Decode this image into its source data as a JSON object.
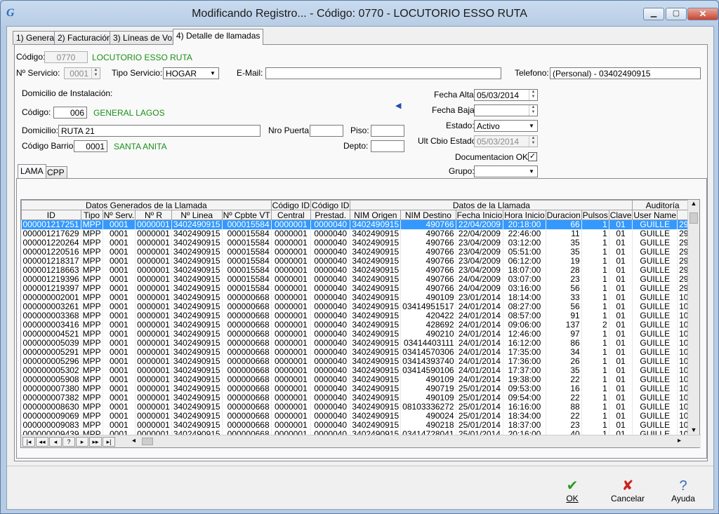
{
  "window": {
    "title": "Modificando Registro... - Código: 0770 - LOCUTORIO ESSO RUTA",
    "app_logo": "G"
  },
  "tabs": [
    {
      "label": "1) General"
    },
    {
      "label": "2) Facturación"
    },
    {
      "label": "3) Líneas de Voz"
    },
    {
      "label": "4) Detalle de llamadas"
    }
  ],
  "header": {
    "codigo_label": "Código:",
    "codigo": "0770",
    "nombre": "LOCUTORIO ESSO RUTA",
    "nservicio_label": "Nº Servicio:",
    "nservicio": "0001",
    "tiposervicio_label": "Tipo Servicio:",
    "tiposervicio": "HOGAR",
    "email_label": "E-Mail:",
    "email": "",
    "telefono_label": "Telefono:",
    "telefono": "(Personal) - 03402490915"
  },
  "domicilio": {
    "section_label": "Domicilio de Instalación:",
    "codigo_label": "Código:",
    "codigo": "006",
    "localidad": "GENERAL LAGOS",
    "domicilio_label": "Domicilio:",
    "domicilio": "RUTA 21",
    "nropuerta_label": "Nro Puerta:",
    "nropuerta": "",
    "piso_label": "Piso:",
    "piso": "",
    "depto_label": "Depto:",
    "depto": "",
    "barrio_label": "Código Barrio:",
    "barrio": "0001",
    "barrio_nombre": "SANTA ANITA"
  },
  "estado": {
    "alta_label": "Fecha Alta:",
    "alta": "05/03/2014",
    "baja_label": "Fecha Baja:",
    "baja": "",
    "estado_label": "Estado:",
    "estado": "Activo",
    "ult_label": "Ult Cbio Estado:",
    "ult": "05/03/2014",
    "doc_label": "Documentacion OK",
    "doc_checked": "✓",
    "grupo_label": "Grupo:",
    "grupo": ""
  },
  "subtabs": [
    {
      "label": "LAMA"
    },
    {
      "label": "CPP"
    }
  ],
  "grid": {
    "groups": [
      {
        "label": "Datos Generados de la Llamada",
        "span": 6
      },
      {
        "label": "Código ID",
        "span": 1
      },
      {
        "label": "Código ID",
        "span": 1
      },
      {
        "label": "Datos de la Llamada",
        "span": 7
      },
      {
        "label": "Auditoría",
        "span": 2
      }
    ],
    "columns": [
      "ID",
      "Tipo",
      "Nº Serv.",
      "Nº R",
      "Nº Linea",
      "Nº Cpbte VT",
      "Central",
      "Prestad.",
      "NIM Origen",
      "NIM Destino",
      "Fecha Inicio",
      "Hora Inicio",
      "Duracion",
      "Pulsos",
      "Clave",
      "User Name",
      ""
    ],
    "rows": [
      [
        "000001217251",
        "MPP",
        "0001",
        "0000001",
        "3402490915",
        "000015584",
        "0000001",
        "0000040",
        "3402490915",
        "490766",
        "22/04/2009",
        "20:18:00",
        "66",
        "1",
        "01",
        "GUILLE",
        "29."
      ],
      [
        "000001217629",
        "MPP",
        "0001",
        "0000001",
        "3402490915",
        "000015584",
        "0000001",
        "0000040",
        "3402490915",
        "490766",
        "22/04/2009",
        "22:46:00",
        "11",
        "1",
        "01",
        "GUILLE",
        "29."
      ],
      [
        "000001220264",
        "MPP",
        "0001",
        "0000001",
        "3402490915",
        "000015584",
        "0000001",
        "0000040",
        "3402490915",
        "490766",
        "23/04/2009",
        "03:12:00",
        "35",
        "1",
        "01",
        "GUILLE",
        "29."
      ],
      [
        "000001220516",
        "MPP",
        "0001",
        "0000001",
        "3402490915",
        "000015584",
        "0000001",
        "0000040",
        "3402490915",
        "490766",
        "23/04/2009",
        "05:51:00",
        "35",
        "1",
        "01",
        "GUILLE",
        "29."
      ],
      [
        "000001218317",
        "MPP",
        "0001",
        "0000001",
        "3402490915",
        "000015584",
        "0000001",
        "0000040",
        "3402490915",
        "490766",
        "23/04/2009",
        "06:12:00",
        "19",
        "1",
        "01",
        "GUILLE",
        "29."
      ],
      [
        "000001218663",
        "MPP",
        "0001",
        "0000001",
        "3402490915",
        "000015584",
        "0000001",
        "0000040",
        "3402490915",
        "490766",
        "23/04/2009",
        "18:07:00",
        "28",
        "1",
        "01",
        "GUILLE",
        "29."
      ],
      [
        "000001219396",
        "MPP",
        "0001",
        "0000001",
        "3402490915",
        "000015584",
        "0000001",
        "0000040",
        "3402490915",
        "490766",
        "24/04/2009",
        "03:07:00",
        "23",
        "1",
        "01",
        "GUILLE",
        "29."
      ],
      [
        "000001219397",
        "MPP",
        "0001",
        "0000001",
        "3402490915",
        "000015584",
        "0000001",
        "0000040",
        "3402490915",
        "490766",
        "24/04/2009",
        "03:16:00",
        "56",
        "1",
        "01",
        "GUILLE",
        "29."
      ],
      [
        "000000002001",
        "MPP",
        "0001",
        "0000001",
        "3402490915",
        "000000668",
        "0000001",
        "0000040",
        "3402490915",
        "490109",
        "23/01/2014",
        "18:14:00",
        "33",
        "1",
        "01",
        "GUILLE",
        "10."
      ],
      [
        "000000003261",
        "MPP",
        "0001",
        "0000001",
        "3402490915",
        "000000668",
        "0000001",
        "0000040",
        "3402490915",
        "03414951517",
        "24/01/2014",
        "08:27:00",
        "56",
        "1",
        "01",
        "GUILLE",
        "10."
      ],
      [
        "000000003368",
        "MPP",
        "0001",
        "0000001",
        "3402490915",
        "000000668",
        "0000001",
        "0000040",
        "3402490915",
        "420422",
        "24/01/2014",
        "08:57:00",
        "91",
        "1",
        "01",
        "GUILLE",
        "10."
      ],
      [
        "000000003416",
        "MPP",
        "0001",
        "0000001",
        "3402490915",
        "000000668",
        "0000001",
        "0000040",
        "3402490915",
        "428692",
        "24/01/2014",
        "09:06:00",
        "137",
        "2",
        "01",
        "GUILLE",
        "10."
      ],
      [
        "000000004521",
        "MPP",
        "0001",
        "0000001",
        "3402490915",
        "000000668",
        "0000001",
        "0000040",
        "3402490915",
        "490210",
        "24/01/2014",
        "12:46:00",
        "97",
        "1",
        "01",
        "GUILLE",
        "10."
      ],
      [
        "000000005039",
        "MPP",
        "0001",
        "0000001",
        "3402490915",
        "000000668",
        "0000001",
        "0000040",
        "3402490915",
        "03414403111",
        "24/01/2014",
        "16:12:00",
        "86",
        "1",
        "01",
        "GUILLE",
        "10."
      ],
      [
        "000000005291",
        "MPP",
        "0001",
        "0000001",
        "3402490915",
        "000000668",
        "0000001",
        "0000040",
        "3402490915",
        "03414570306",
        "24/01/2014",
        "17:35:00",
        "34",
        "1",
        "01",
        "GUILLE",
        "10."
      ],
      [
        "000000005296",
        "MPP",
        "0001",
        "0000001",
        "3402490915",
        "000000668",
        "0000001",
        "0000040",
        "3402490915",
        "03414393740",
        "24/01/2014",
        "17:36:00",
        "26",
        "1",
        "01",
        "GUILLE",
        "10."
      ],
      [
        "000000005302",
        "MPP",
        "0001",
        "0000001",
        "3402490915",
        "000000668",
        "0000001",
        "0000040",
        "3402490915",
        "03414590106",
        "24/01/2014",
        "17:37:00",
        "35",
        "1",
        "01",
        "GUILLE",
        "10."
      ],
      [
        "000000005908",
        "MPP",
        "0001",
        "0000001",
        "3402490915",
        "000000668",
        "0000001",
        "0000040",
        "3402490915",
        "490109",
        "24/01/2014",
        "19:38:00",
        "22",
        "1",
        "01",
        "GUILLE",
        "10."
      ],
      [
        "000000007380",
        "MPP",
        "0001",
        "0000001",
        "3402490915",
        "000000668",
        "0000001",
        "0000040",
        "3402490915",
        "490719",
        "25/01/2014",
        "09:53:00",
        "16",
        "1",
        "01",
        "GUILLE",
        "10."
      ],
      [
        "000000007382",
        "MPP",
        "0001",
        "0000001",
        "3402490915",
        "000000668",
        "0000001",
        "0000040",
        "3402490915",
        "490109",
        "25/01/2014",
        "09:54:00",
        "22",
        "1",
        "01",
        "GUILLE",
        "10."
      ],
      [
        "000000008630",
        "MPP",
        "0001",
        "0000001",
        "3402490915",
        "000000668",
        "0000001",
        "0000040",
        "3402490915",
        "08103336272",
        "25/01/2014",
        "16:16:00",
        "88",
        "1",
        "01",
        "GUILLE",
        "10."
      ],
      [
        "000000009069",
        "MPP",
        "0001",
        "0000001",
        "3402490915",
        "000000668",
        "0000001",
        "0000040",
        "3402490915",
        "490024",
        "25/01/2014",
        "18:34:00",
        "22",
        "1",
        "01",
        "GUILLE",
        "10."
      ],
      [
        "000000009083",
        "MPP",
        "0001",
        "0000001",
        "3402490915",
        "000000668",
        "0000001",
        "0000040",
        "3402490915",
        "490218",
        "25/01/2014",
        "18:37:00",
        "23",
        "1",
        "01",
        "GUILLE",
        "10."
      ],
      [
        "000000009439",
        "MPP",
        "0001",
        "0000001",
        "3402490915",
        "000000668",
        "0000001",
        "0000040",
        "3402490915",
        "03414728041",
        "25/01/2014",
        "20:16:00",
        "40",
        "1",
        "01",
        "GUILLE",
        "10."
      ]
    ]
  },
  "navigator": [
    "|◂",
    "◂◂",
    "◂",
    "?",
    "▸",
    "▸▸",
    "▸|"
  ],
  "buttons": {
    "ok": "OK",
    "cancel": "Cancelar",
    "help": "Ayuda"
  },
  "colors": {
    "selection": "#3399ff",
    "green_text": "#199019",
    "title_bg": "#b9cde5"
  }
}
